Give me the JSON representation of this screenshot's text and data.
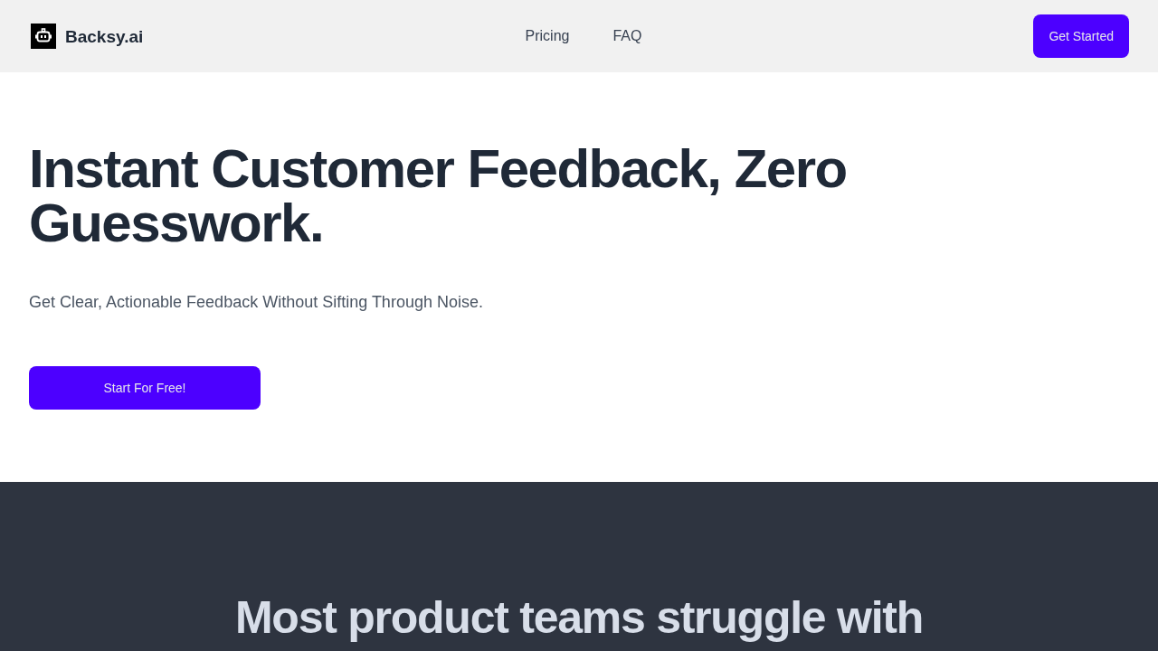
{
  "header": {
    "logo": {
      "text": "Backsy.ai"
    },
    "nav": [
      {
        "label": "Pricing"
      },
      {
        "label": "FAQ"
      }
    ],
    "cta": {
      "label": "Get Started"
    }
  },
  "hero": {
    "title": "Instant Customer Feedback, Zero Guesswork.",
    "subtitle": "Get Clear, Actionable Feedback Without Sifting Through Noise.",
    "cta": {
      "label": "Start For Free!"
    }
  },
  "problem_section": {
    "title": "Most product teams struggle with"
  }
}
